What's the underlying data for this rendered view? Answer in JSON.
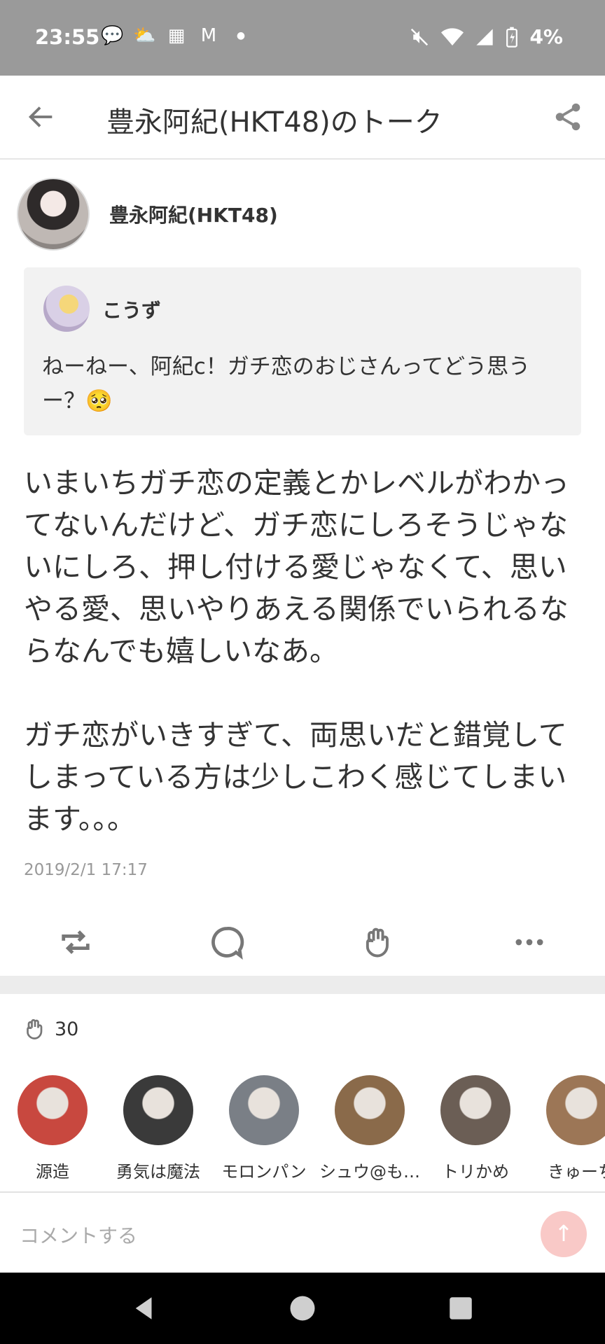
{
  "status_bar": {
    "time": "23:55",
    "left_icons": [
      "chat-icon",
      "weather-icon",
      "calendar-icon",
      "gmail-icon",
      "dot-icon"
    ],
    "right_icons": [
      "mute-icon",
      "wifi-icon",
      "signal-icon",
      "battery-icon"
    ],
    "battery": "4%"
  },
  "app_bar": {
    "title": "豊永阿紀(HKT48)のトーク"
  },
  "post": {
    "author": "豊永阿紀(HKT48)",
    "quote": {
      "name": "こうず",
      "text": "ねーねー、阿紀c！ガチ恋のおじさんってどう思うー？🥺"
    },
    "body_paragraphs": [
      "いまいちガチ恋の定義とかレベルがわかってないんだけど、ガチ恋にしろそうじゃないにしろ、押し付ける愛じゃなくて、思いやる愛、思いやりあえる関係でいられるならなんでも嬉しいなあ。",
      "ガチ恋がいきすぎて、両思いだと錯覚してしまっている方は少しこわく感じてしまいます。。。"
    ],
    "timestamp": "2019/2/1 17:17"
  },
  "likes": {
    "count": "30",
    "users": [
      {
        "name": "源造",
        "color": "#c8483f"
      },
      {
        "name": "勇気は魔法",
        "color": "#3a3a3a"
      },
      {
        "name": "モロンパン",
        "color": "#7a7f86"
      },
      {
        "name": "シュウ@も…",
        "color": "#8a6a4a"
      },
      {
        "name": "トリかめ",
        "color": "#6b5e55"
      },
      {
        "name": "きゅーち",
        "color": "#9c7656"
      }
    ]
  },
  "comment": {
    "placeholder": "コメントする"
  },
  "colors": {
    "status_bar": "#9a9a9a",
    "send_button": "#f9c9c7",
    "separator": "#ececec"
  }
}
